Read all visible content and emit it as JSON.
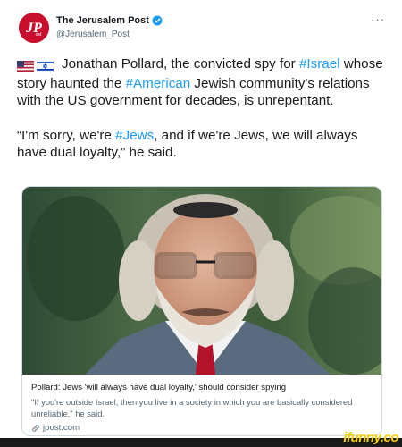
{
  "account": {
    "display_name": "The Jerusalem Post",
    "handle": "@Jerusalem_Post",
    "avatar_text": "JP"
  },
  "tweet": {
    "para1_a": "Jonathan Pollard, the convicted spy for ",
    "para1_tag1": "#Israel",
    "para1_b": " whose story haunted the ",
    "para1_tag2": "#American",
    "para1_c": " Jewish community's relations with the US government for decades, is unrepentant.",
    "para2_a": "“I'm sorry, we're ",
    "para2_tag": "#Jews",
    "para2_b": ", and if we're Jews, we will always have dual loyalty,” he said."
  },
  "card": {
    "title": "Pollard: Jews 'will always have dual loyalty,' should consider spying",
    "description": "\"If you're outside Israel, then you live in a society in which you are basically considered unreliable,\" he said.",
    "domain": "jpost.com"
  },
  "watermark": "ifunny.co",
  "colors": {
    "hashtag": "#1d9bf0",
    "verified": "#1d9bf0",
    "brand_red": "#c8102e"
  },
  "icons": {
    "flags": [
      "us-flag-icon",
      "israel-flag-icon"
    ],
    "verified": "verified-badge-icon",
    "more": "more-options-icon",
    "link": "link-icon"
  }
}
